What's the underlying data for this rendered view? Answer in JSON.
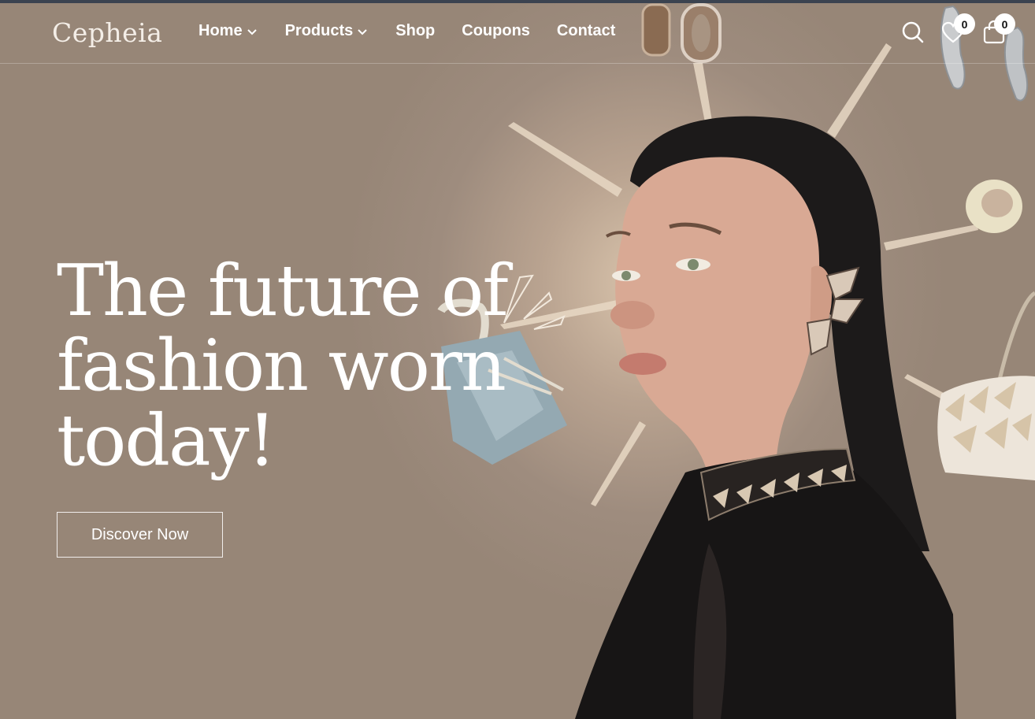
{
  "brand": {
    "name": "Cepheia"
  },
  "nav": {
    "items": [
      {
        "label": "Home",
        "has_dropdown": true
      },
      {
        "label": "Products",
        "has_dropdown": true
      },
      {
        "label": "Shop",
        "has_dropdown": false
      },
      {
        "label": "Coupons",
        "has_dropdown": false
      },
      {
        "label": "Contact",
        "has_dropdown": false
      }
    ]
  },
  "header_icons": {
    "search": {
      "icon": "search-icon"
    },
    "wishlist": {
      "icon": "heart-icon",
      "count": "0"
    },
    "cart": {
      "icon": "shopping-bag-icon",
      "count": "0"
    }
  },
  "hero": {
    "headline_lines": [
      "The future of",
      "fashion worn",
      "today!"
    ],
    "cta_label": "Discover Now",
    "image": "woman-with-jewelry-and-bags-photo"
  },
  "colors": {
    "background": "#9c8b7d",
    "accent_glow": "#d9c4ac",
    "text": "#ffffff",
    "topbar": "#3b4350"
  }
}
